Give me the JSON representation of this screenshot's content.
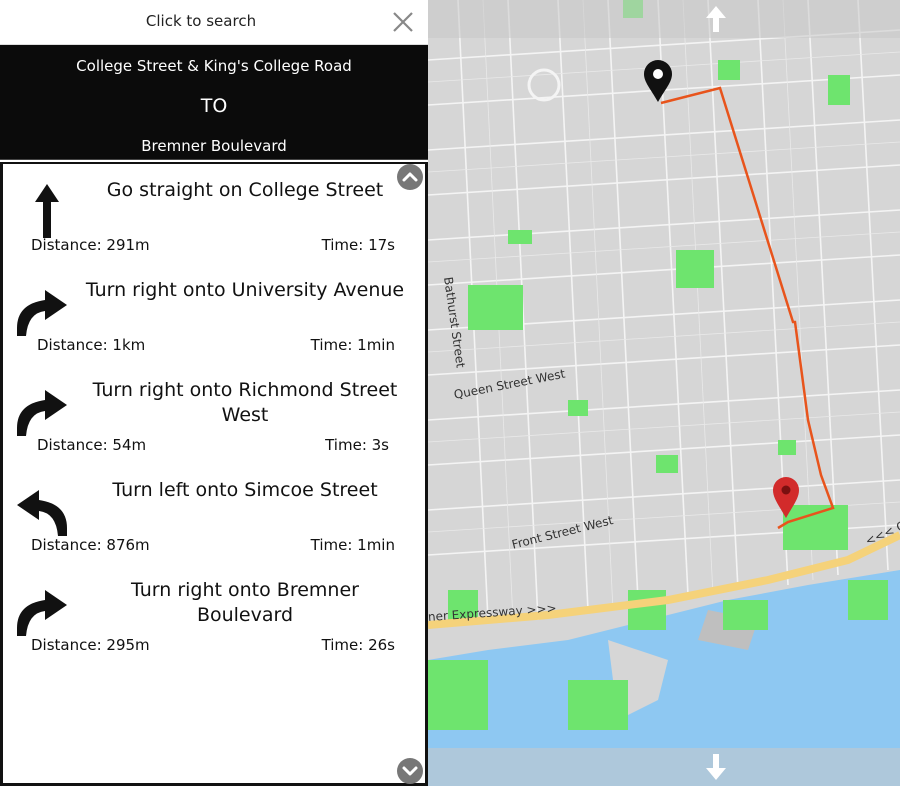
{
  "search": {
    "label": "Click to search"
  },
  "route": {
    "from": "College Street & King's College Road",
    "to_label": "TO",
    "destination": "Bremner Boulevard"
  },
  "steps": [
    {
      "direction": "straight",
      "instruction": "Go straight on College Street",
      "distance": "Distance: 291m",
      "time": "Time: 17s"
    },
    {
      "direction": "right",
      "instruction": "Turn right onto University Avenue",
      "distance": "Distance: 1km",
      "time": "Time: 1min"
    },
    {
      "direction": "right",
      "instruction": "Turn right onto Richmond Street West",
      "distance": "Distance: 54m",
      "time": "Time: 3s"
    },
    {
      "direction": "left",
      "instruction": "Turn left onto Simcoe Street",
      "distance": "Distance: 876m",
      "time": "Time: 1min"
    },
    {
      "direction": "right",
      "instruction": "Turn right onto Bremner Boulevard",
      "distance": "Distance: 295m",
      "time": "Time: 26s"
    }
  ],
  "map": {
    "labels": {
      "bathurst": "Bathurst Street",
      "queen": "Queen Street West",
      "front": "Front Street West",
      "expressway": "ner Expressway >>>",
      "gardiner": "<<< Gar"
    },
    "colors": {
      "route": "#e8541c",
      "park": "#6ee46e",
      "water": "#8ec8f2",
      "highway": "#f5d27a",
      "land": "#d6d6d6",
      "block": "#c4c4c4",
      "start_marker": "#111111",
      "end_marker": "#d22b2b"
    }
  }
}
